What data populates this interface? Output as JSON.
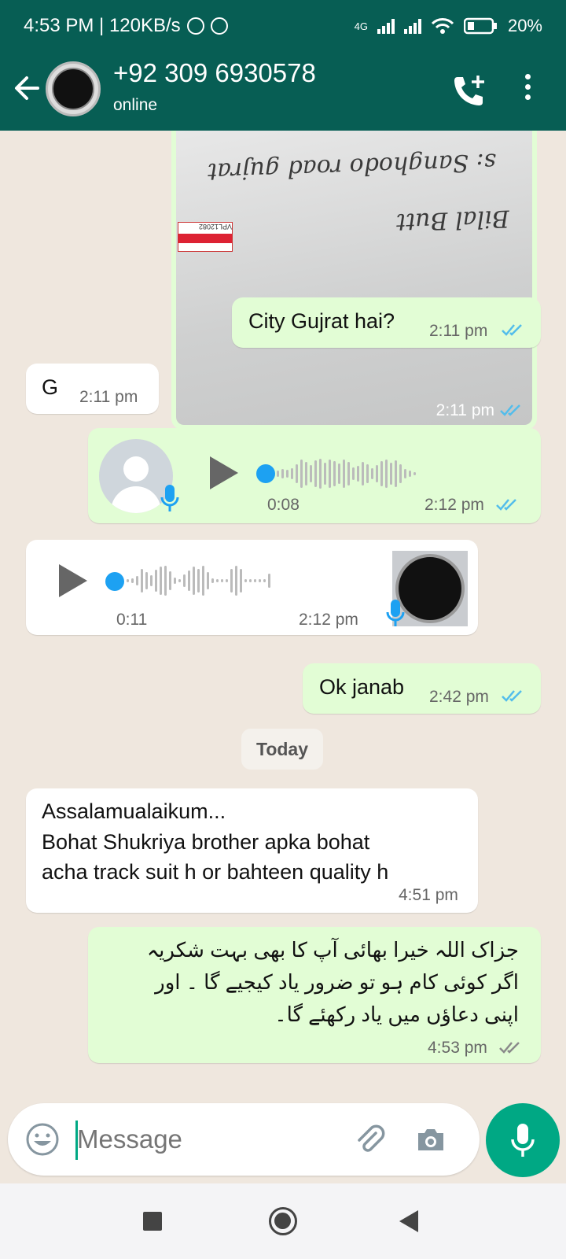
{
  "status_bar": {
    "time_speed": "4:53 PM | 120KB/s",
    "network": "4G",
    "battery": "20%"
  },
  "header": {
    "contact": "+92 309 6930578",
    "presence": "online"
  },
  "image_message": {
    "time": "2:11 pm",
    "photo_text": {
      "line1": "s: Sanghodo road gujrat",
      "line2": "Bilal Butt",
      "sticker": "VPL12082"
    }
  },
  "messages": [
    {
      "id": "m1",
      "dir": "out",
      "text": "City Gujrat hai?",
      "time": "2:11 pm"
    },
    {
      "id": "m2",
      "dir": "in",
      "text": "G",
      "time": "2:11 pm"
    },
    {
      "id": "m5",
      "dir": "out",
      "text": "Ok janab",
      "time": "2:42 pm"
    }
  ],
  "voice_out": {
    "duration": "0:08",
    "time": "2:12 pm"
  },
  "voice_in": {
    "duration": "0:11",
    "time": "2:12 pm"
  },
  "day_divider": "Today",
  "greeting_message": {
    "line1": "Assalamualaikum...",
    "line2": "Bohat Shukriya brother apka bohat",
    "line3": "acha track suit h or bahteen quality h",
    "time": "4:51 pm"
  },
  "reply_message": {
    "line1": "جزاک اللہ خیرا بھائی آپ کا بھی بہت شکریہ",
    "line2": "اگر کوئی کام ہو تو ضرور یاد کیجیے گا ۔ اور",
    "line3": "اپنی دعاؤں میں یاد رکھئے گا۔",
    "time": "4:53 pm"
  },
  "composer": {
    "placeholder": "Message"
  },
  "colors": {
    "header": "#075e54",
    "outgoing": "#e2fdd5",
    "incoming": "#ffffff",
    "accent": "#00a884",
    "read_ticks": "#53bdeb"
  }
}
